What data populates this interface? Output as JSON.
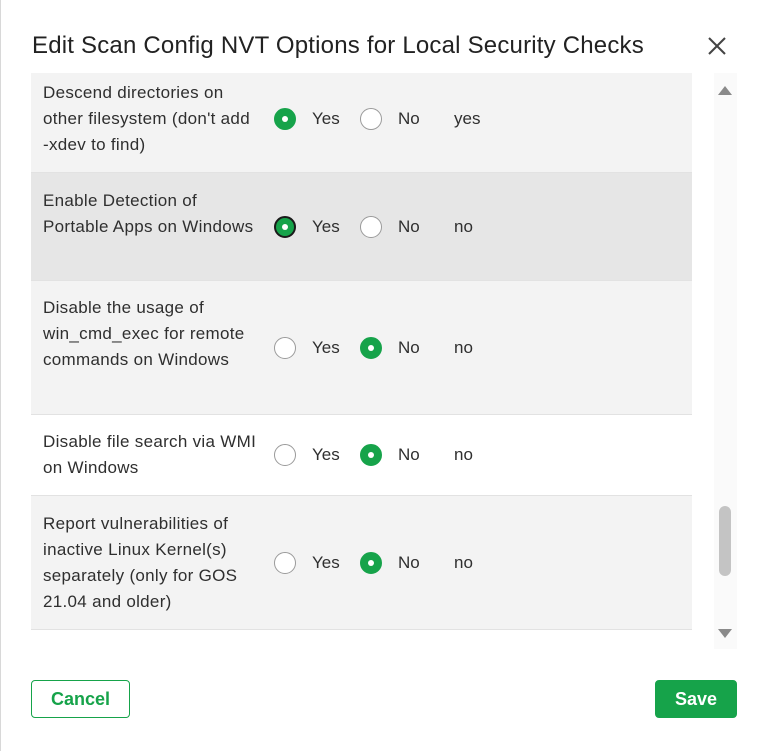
{
  "dialog": {
    "title": "Edit Scan Config NVT Options for Local Security Checks",
    "close_icon": "close-icon"
  },
  "options": {
    "yes_label": "Yes",
    "no_label": "No"
  },
  "rows": [
    {
      "label": "Descend directories on other filesystem (don't add -xdev to find)",
      "selected": "yes",
      "value": "yes"
    },
    {
      "label": "Enable Detection of Portable Apps on Windows",
      "selected": "yes",
      "value": "no"
    },
    {
      "label": "Disable the usage of win_cmd_exec for remote commands on Windows",
      "selected": "no",
      "value": "no"
    },
    {
      "label": "Disable file search via WMI on Windows",
      "selected": "no",
      "value": "no"
    },
    {
      "label": "Report vulnerabilities of inactive Linux Kernel(s) separately (only for GOS 21.04 and older)",
      "selected": "no",
      "value": "no"
    }
  ],
  "footer": {
    "cancel_label": "Cancel",
    "save_label": "Save"
  },
  "colors": {
    "accent": "#16a34a"
  }
}
